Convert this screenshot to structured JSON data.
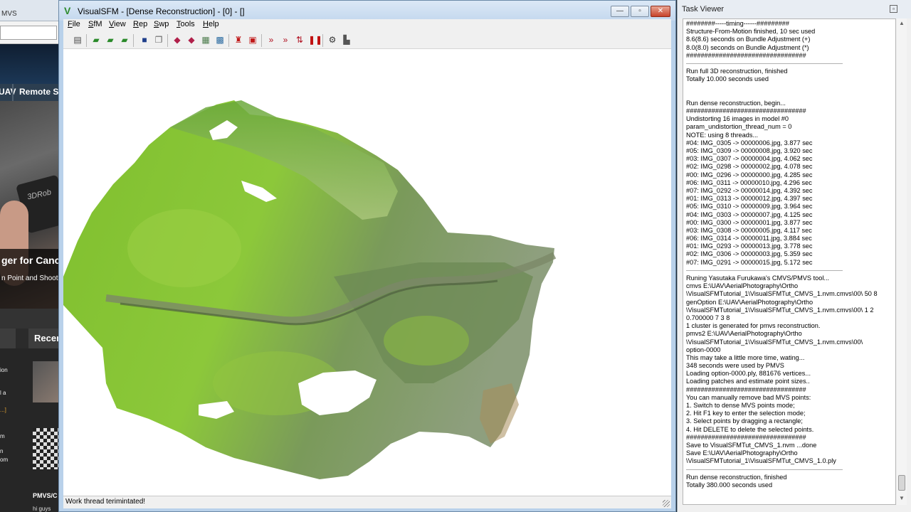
{
  "background_browser": {
    "tab_text": "MVS",
    "nav_items": [
      "UAV",
      "Remote S"
    ],
    "headline": "ger for Canc",
    "subhead": "n Point and Shoot",
    "recent_heading": "Recen",
    "snippets": [
      "ion",
      "l a",
      "...]",
      "m",
      "n",
      "om"
    ],
    "post_title": "PMVS/C",
    "post_body": "hi guys"
  },
  "vsfm": {
    "title": "VisualSFM - [Dense Reconstruction] - [0] - []",
    "app_icon": "visualsfm-logo-icon",
    "window_buttons": {
      "minimize": "—",
      "maximize": "▫",
      "close": "✕"
    },
    "menu": [
      {
        "label": "File",
        "key": "F"
      },
      {
        "label": "SfM",
        "key": "S"
      },
      {
        "label": "View",
        "key": "V"
      },
      {
        "label": "Rep",
        "key": "R"
      },
      {
        "label": "Swp",
        "key": "S"
      },
      {
        "label": "Tools",
        "key": "T"
      },
      {
        "label": "Help",
        "key": "H"
      }
    ],
    "toolbar_icons": [
      "list-icon",
      "open-icon",
      "open-multi-icon",
      "open-nvm-icon",
      "save-icon",
      "save-all-icon",
      "match-icon",
      "match-set-icon",
      "grid-icon",
      "pairs-icon",
      "reconstruct-icon",
      "sparse-icon",
      "run-all-icon",
      "run-dense-icon",
      "split-icon",
      "pause-icon",
      "gear-icon",
      "chart-icon"
    ],
    "status": "Work thread terimintated!",
    "colors": {
      "canvas": "#ffffff",
      "chrome": "#b9d1ea"
    }
  },
  "task_viewer": {
    "title": "Task Viewer",
    "lines": [
      "########-----timing------#########",
      "Structure-From-Motion finished, 10 sec used",
      "8.6(8.6) seconds on Bundle Adjustment (+)",
      "8.0(8.0) seconds on Bundle Adjustment (*)",
      "#################################",
      "---",
      "Run full 3D reconstruction, finished",
      "Totally 10.000 seconds used",
      "",
      "",
      "Run dense reconstruction, begin...",
      "#################################",
      "Undistorting 16 images in model #0",
      "param_undistortion_thread_num = 0",
      "NOTE: using 8 threads...",
      "#04: IMG_0305 -> 00000006.jpg, 3.877 sec",
      "#05: IMG_0309 -> 00000008.jpg, 3.920 sec",
      "#03: IMG_0307 -> 00000004.jpg, 4.062 sec",
      "#02: IMG_0298 -> 00000002.jpg, 4.078 sec",
      "#00: IMG_0296 -> 00000000.jpg, 4.285 sec",
      "#06: IMG_0311 -> 00000010.jpg, 4.296 sec",
      "#07: IMG_0292 -> 00000014.jpg, 4.392 sec",
      "#01: IMG_0313 -> 00000012.jpg, 4.397 sec",
      "#05: IMG_0310 -> 00000009.jpg, 3.964 sec",
      "#04: IMG_0303 -> 00000007.jpg, 4.125 sec",
      "#00: IMG_0300 -> 00000001.jpg, 3.877 sec",
      "#03: IMG_0308 -> 00000005.jpg, 4.117 sec",
      "#06: IMG_0314 -> 00000011.jpg, 3.884 sec",
      "#01: IMG_0293 -> 00000013.jpg, 3.778 sec",
      "#02: IMG_0306 -> 00000003.jpg, 5.359 sec",
      "#07: IMG_0291 -> 00000015.jpg, 5.172 sec",
      "---",
      "Runing Yasutaka Furukawa's CMVS/PMVS tool...",
      "cmvs E:\\UAV\\AerialPhotography\\Ortho",
      "\\VisualSFMTutorial_1\\VisualSFMTut_CMVS_1.nvm.cmvs\\00\\ 50 8",
      "genOption E:\\UAV\\AerialPhotography\\Ortho",
      "\\VisualSFMTutorial_1\\VisualSFMTut_CMVS_1.nvm.cmvs\\00\\ 1 2",
      "0.700000 7 3 8",
      "1 cluster is generated for pmvs reconstruction.",
      "pmvs2 E:\\UAV\\AerialPhotography\\Ortho",
      "\\VisualSFMTutorial_1\\VisualSFMTut_CMVS_1.nvm.cmvs\\00\\",
      "option-0000",
      "This may take a little more time, wating...",
      "348 seconds were used by PMVS",
      "Loading option-0000.ply, 881676 vertices...",
      "Loading  patches and estimate point sizes..",
      "#################################",
      "You can manually remove bad MVS points:",
      "1. Switch to dense MVS points mode;",
      "2. Hit F1 key to enter the selection mode;",
      "3. Select points by dragging a rectangle;",
      "4. Hit DELETE to delete the selected points.",
      "#################################",
      "Save to VisualSFMTut_CMVS_1.nvm ...done",
      "Save E:\\UAV\\AerialPhotography\\Ortho",
      "\\VisualSFMTutorial_1\\VisualSFMTut_CMVS_1.0.ply",
      "---",
      "Run dense reconstruction, finished",
      "Totally 380.000 seconds used"
    ]
  }
}
